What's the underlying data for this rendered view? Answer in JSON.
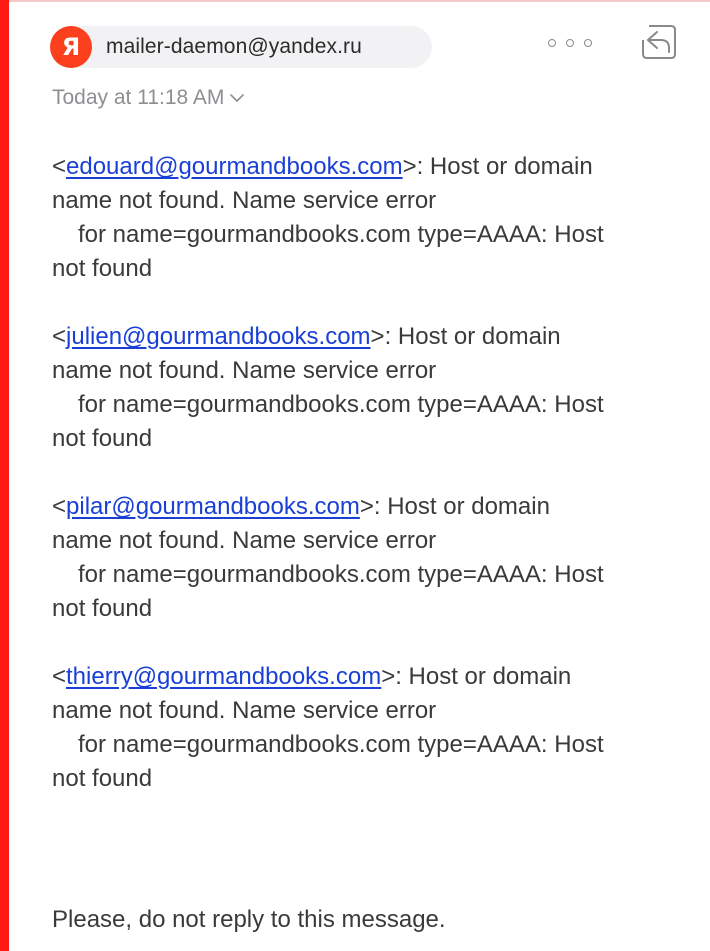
{
  "header": {
    "sender_logo_letter": "Я",
    "sender_email": "mailer-daemon@yandex.ru",
    "more_icon": "more-horizontal-icon",
    "reply_icon": "reply-icon",
    "date_label": "Today at 11:18 AM",
    "chevron_icon": "chevron-down-icon"
  },
  "colors": {
    "accent_bar": "#ff1a14",
    "logo_bg": "#fc3f1d",
    "link": "#1a3fd6"
  },
  "errors": [
    {
      "open": "<",
      "email": "edouard@gourmandbooks.com",
      "after_email": ">: Host or domain",
      "line2": "name not found. Name service error",
      "line3": "for name=gourmandbooks.com type=AAAA: Host",
      "line4": "not found"
    },
    {
      "open": "<",
      "email": "julien@gourmandbooks.com",
      "after_email": ">: Host or domain",
      "line2": "name not found. Name service error",
      "line3": "for name=gourmandbooks.com type=AAAA: Host",
      "line4": "not found"
    },
    {
      "open": "<",
      "email": "pilar@gourmandbooks.com",
      "after_email": ">: Host or domain",
      "line2": "name not found. Name service error",
      "line3": "for name=gourmandbooks.com type=AAAA: Host",
      "line4": "not found"
    },
    {
      "open": "<",
      "email": "thierry@gourmandbooks.com",
      "after_email": ">: Host or domain",
      "line2": "name not found. Name service error",
      "line3": "for name=gourmandbooks.com type=AAAA: Host",
      "line4": "not found"
    }
  ],
  "footer": {
    "note": "Please, do not reply to this message."
  }
}
